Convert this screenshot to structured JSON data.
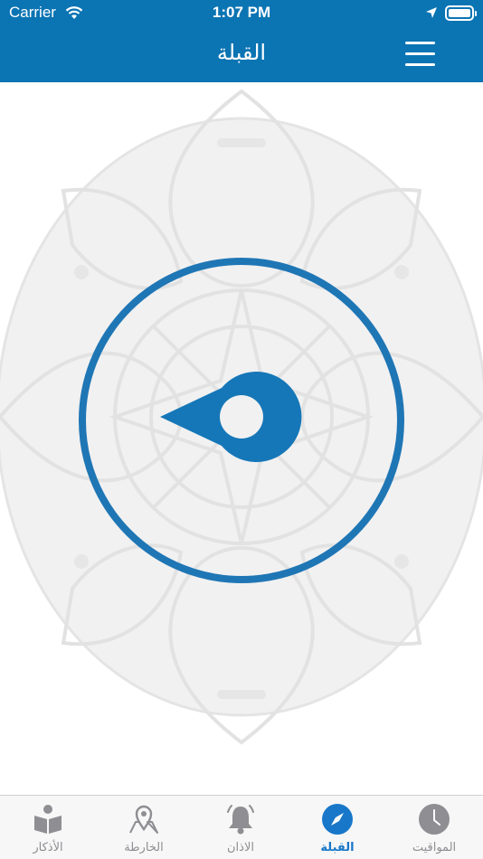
{
  "status_bar": {
    "carrier": "Carrier",
    "time": "1:07 PM"
  },
  "nav": {
    "title": "القبلة",
    "menu_icon": "hamburger-menu-icon"
  },
  "compass": {
    "icon": "qibla-pointer-icon",
    "ring_color": "#1f76b5"
  },
  "tabs": [
    {
      "label": "المواقيت",
      "icon": "clock-icon",
      "active": false
    },
    {
      "label": "القبلة",
      "icon": "compass-icon",
      "active": true
    },
    {
      "label": "الاذان",
      "icon": "bell-icon",
      "active": false
    },
    {
      "label": "الخارطة",
      "icon": "map-pin-icon",
      "active": false
    },
    {
      "label": "الأذكار",
      "icon": "book-reader-icon",
      "active": false
    }
  ],
  "colors": {
    "header": "#0b74b3",
    "accent": "#1877c9",
    "inactive": "#8e8e93"
  }
}
